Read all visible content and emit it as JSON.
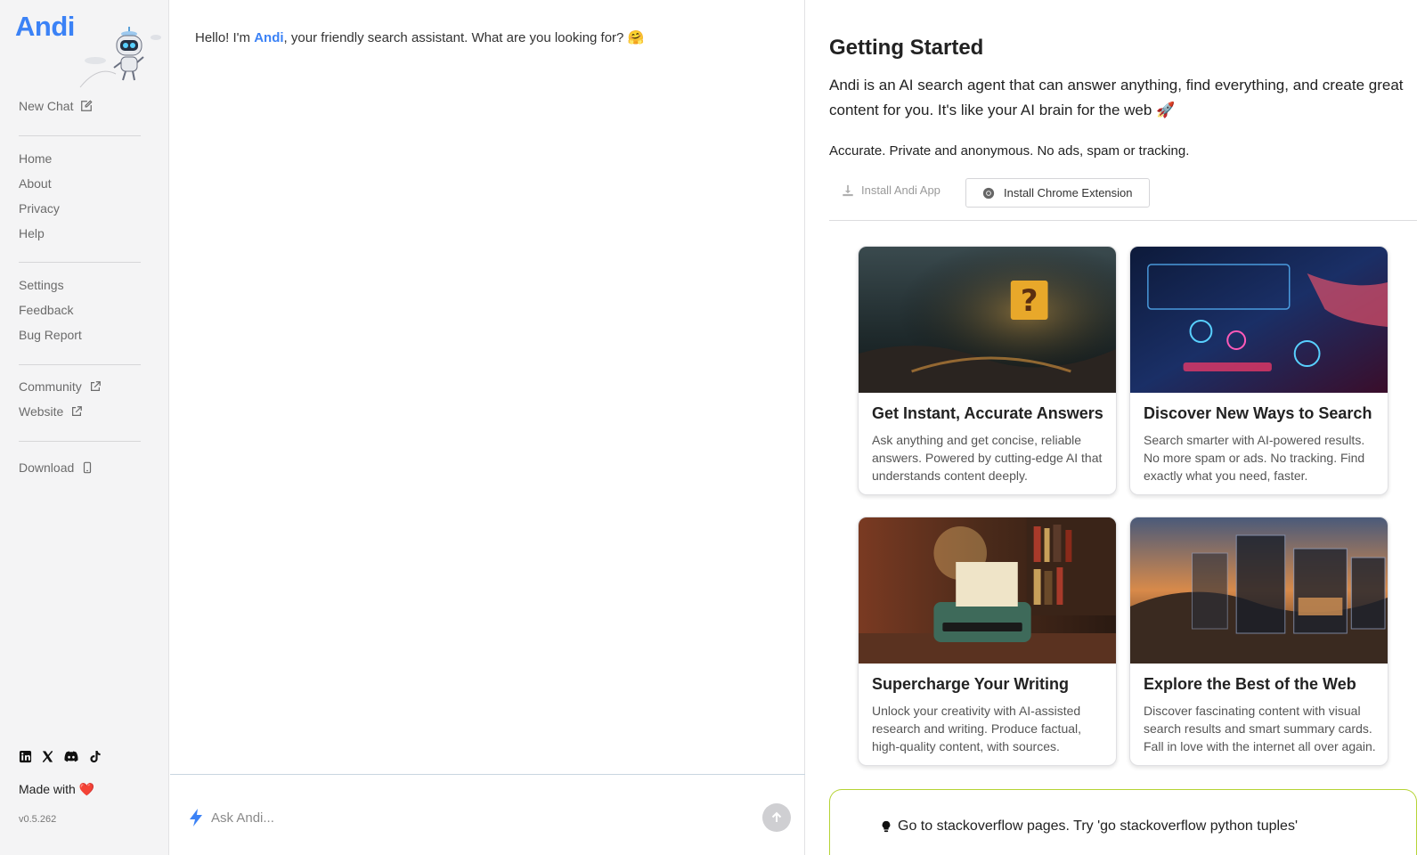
{
  "sidebar": {
    "logo": "Andi",
    "new_chat": "New Chat",
    "nav_primary": [
      "Home",
      "About",
      "Privacy",
      "Help"
    ],
    "nav_secondary": [
      "Settings",
      "Feedback",
      "Bug Report"
    ],
    "community": "Community",
    "website": "Website",
    "download": "Download",
    "social_icons": [
      "linkedin-icon",
      "x-icon",
      "discord-icon",
      "tiktok-icon"
    ],
    "made_with": "Made with",
    "heart": "❤️",
    "version": "v0.5.262"
  },
  "chat": {
    "greeting_prefix": "Hello! I'm ",
    "greeting_brand": "Andi",
    "greeting_suffix": ", your friendly search assistant. What are you looking for? 🤗",
    "input_placeholder": "Ask Andi...",
    "input_value": ""
  },
  "getting_started": {
    "title": "Getting Started",
    "description": "Andi is an AI search agent that can answer anything, find everything, and create great content for you. It's like your AI brain for the web 🚀",
    "subtitle": "Accurate. Private and anonymous. No ads, spam or tracking.",
    "install_app": "Install Andi App",
    "install_chrome": "Install Chrome Extension"
  },
  "cards": [
    {
      "title": "Get Instant, Accurate Answers",
      "text": "Ask anything and get concise, reliable answers. Powered by cutting-edge AI that understands content deeply."
    },
    {
      "title": "Discover New Ways to Search",
      "text": "Search smarter with AI-powered results. No more spam or ads. No tracking. Find exactly what you need, faster."
    },
    {
      "title": "Supercharge Your Writing",
      "text": "Unlock your creativity with AI-assisted research and writing. Produce factual, high-quality content, with sources."
    },
    {
      "title": "Explore the Best of the Web",
      "text": "Discover fascinating content with visual search results and smart summary cards. Fall in love with the internet all over again."
    }
  ],
  "tip": {
    "text": "Go to stackoverflow pages. Try 'go stackoverflow python tuples'"
  },
  "colors": {
    "brand": "#3b82f6",
    "tip_border": "#b5d334",
    "sidebar_bg": "#f4f4f5"
  }
}
